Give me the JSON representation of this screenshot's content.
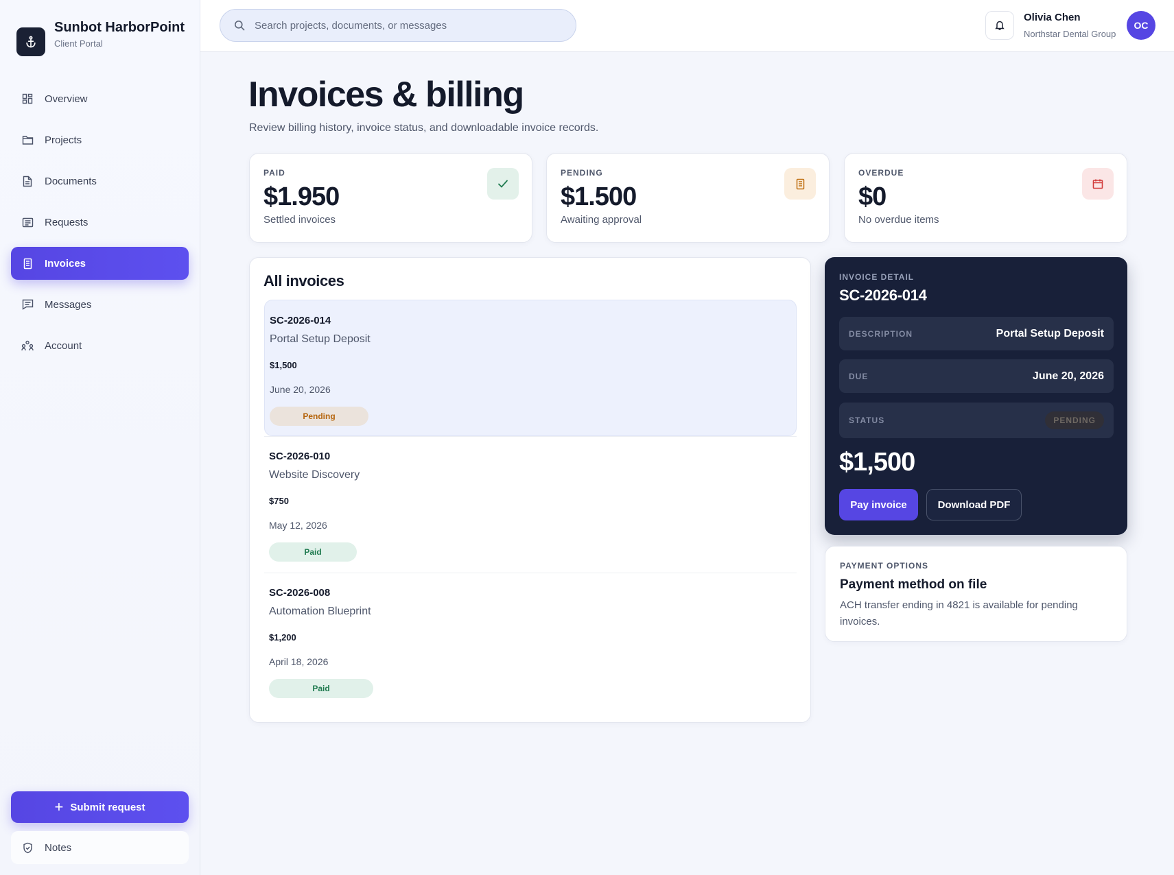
{
  "brand": {
    "name": "Sunbot HarborPoint",
    "subtitle": "Client Portal",
    "logo_icon": "anchor-icon"
  },
  "sidebar": {
    "items": [
      {
        "label": "Overview",
        "icon": "layout-grid-icon",
        "active": false
      },
      {
        "label": "Projects",
        "icon": "folder-icon",
        "active": false
      },
      {
        "label": "Documents",
        "icon": "document-icon",
        "active": false
      },
      {
        "label": "Requests",
        "icon": "list-icon",
        "active": false
      },
      {
        "label": "Invoices",
        "icon": "receipt-icon",
        "active": true
      },
      {
        "label": "Messages",
        "icon": "message-icon",
        "active": false
      },
      {
        "label": "Account",
        "icon": "people-icon",
        "active": false
      }
    ],
    "submit_label": "Submit request",
    "notes_label": "Notes"
  },
  "topbar": {
    "search_placeholder": "Search projects, documents, or messages",
    "user_name": "Olivia Chen",
    "user_org": "Northstar Dental Group",
    "avatar_initials": "OC"
  },
  "page": {
    "title": "Invoices & billing",
    "subtitle": "Review billing history, invoice status, and downloadable invoice records."
  },
  "stats": [
    {
      "label": "PAID",
      "value": "$1.950",
      "note": "Settled invoices",
      "icon": "check-icon",
      "icon_bg": "#e3f1ea",
      "icon_color": "#1f7a4f"
    },
    {
      "label": "PENDING",
      "value": "$1.500",
      "note": "Awaiting approval",
      "icon": "receipt-icon",
      "icon_bg": "#fbeede",
      "icon_color": "#c07012"
    },
    {
      "label": "OVERDUE",
      "value": "$0",
      "note": "No overdue items",
      "icon": "calendar-icon",
      "icon_bg": "#fbe6e6",
      "icon_color": "#d23a3a"
    }
  ],
  "invoices": {
    "title": "All invoices",
    "rows": [
      {
        "id": "SC-2026-014",
        "description": "Portal Setup Deposit",
        "amount": "$1,500",
        "due": "June 20, 2026",
        "status": "Pending",
        "selected": true
      },
      {
        "id": "SC-2026-010",
        "description": "Website Discovery",
        "amount": "$750",
        "due": "May 12, 2026",
        "status": "Paid",
        "selected": false
      },
      {
        "id": "SC-2026-008",
        "description": "Automation Blueprint",
        "amount": "$1,200",
        "due": "April 18, 2026",
        "status": "Paid",
        "selected": false
      }
    ]
  },
  "detail": {
    "label": "INVOICE DETAIL",
    "id": "SC-2026-014",
    "description_key": "DESCRIPTION",
    "description": "Portal Setup Deposit",
    "due_key": "DUE",
    "due": "June 20, 2026",
    "status_key": "STATUS",
    "status": "PENDING",
    "amount": "$1,500",
    "pay_label": "Pay invoice",
    "download_label": "Download PDF"
  },
  "payment": {
    "label": "PAYMENT OPTIONS",
    "title": "Payment method on file",
    "description": "ACH transfer ending in 4821 is available for pending invoices."
  },
  "colors": {
    "accent": "#5646e3",
    "dark_panel": "#182039",
    "background": "#f4f6fc"
  }
}
